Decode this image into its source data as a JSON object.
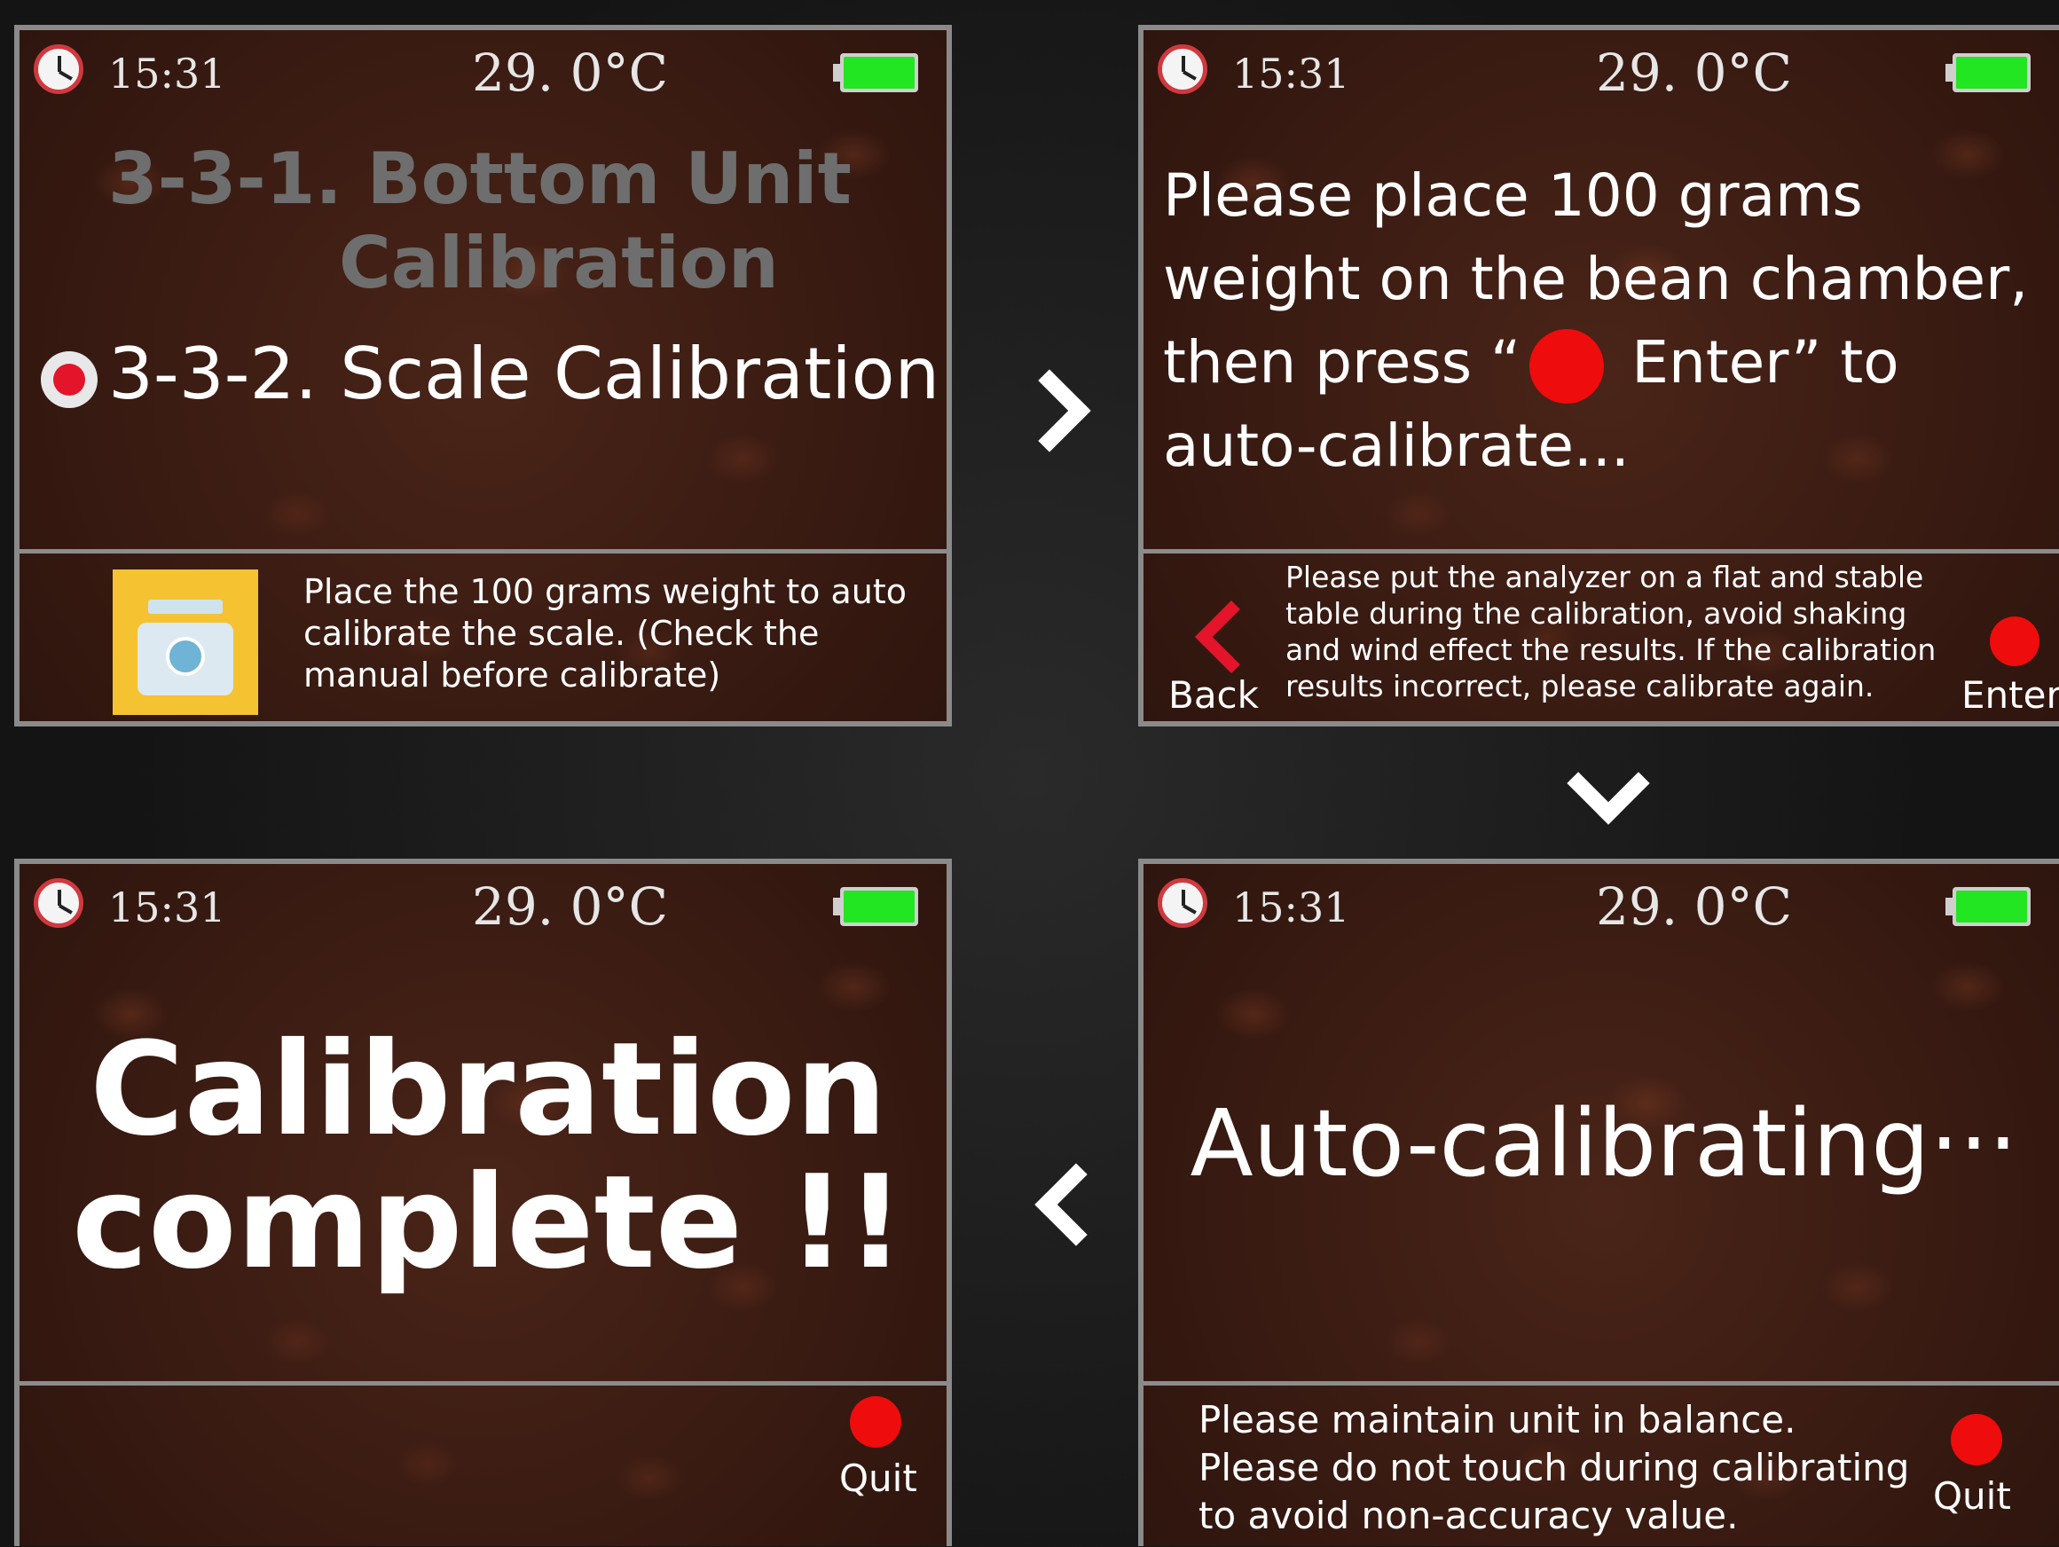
{
  "status": {
    "time": "15:31",
    "temperature": "29. 0°C",
    "battery_level": 1.0,
    "battery_color": "#22e622"
  },
  "screen1": {
    "menu_item_1": {
      "line1": "3-3-1. Bottom Unit",
      "line2": "Calibration"
    },
    "menu_item_2": "3-3-2. Scale Calibration",
    "note": "Place the 100 grams weight to auto calibrate the scale. (Check the manual before calibrate)",
    "icons": [
      "clock-icon",
      "battery-icon",
      "radio-selected-icon",
      "scale-icon"
    ]
  },
  "screen2": {
    "msg_part1": "Please place 100 grams weight on the bean chamber, then press “",
    "msg_part2": " Enter”  to auto-calibrate...",
    "note": "Please put the analyzer on a flat and stable table during the calibration, avoid shaking and wind effect the results. If the calibration results incorrect, please calibrate again.",
    "back_label": "Back",
    "enter_label": "Enter"
  },
  "screen3": {
    "message": "Calibration complete !!",
    "quit_label": "Quit"
  },
  "screen4": {
    "message": "Auto-calibrating···",
    "note": "Please maintain unit in balance. Please do not touch during calibrating to avoid non-accuracy value.",
    "quit_label": "Quit"
  },
  "colors": {
    "accent_red": "#ee0c0c",
    "screen_border": "#8a8a8a",
    "disabled_text": "#6e6e6e"
  }
}
